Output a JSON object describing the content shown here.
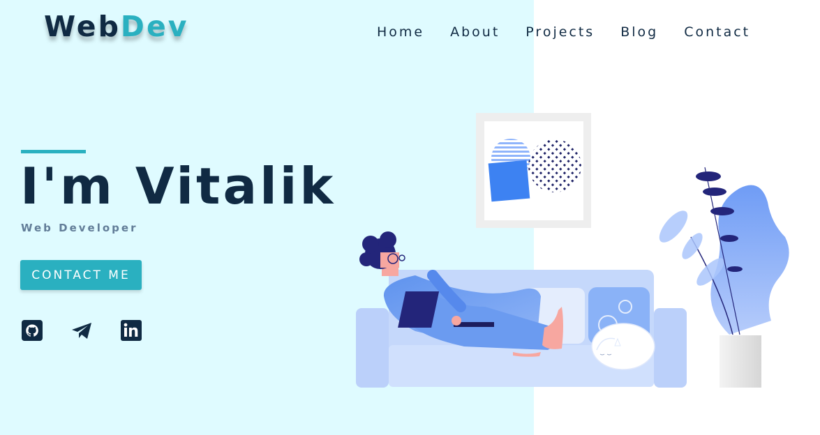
{
  "brand": {
    "part1": "Web",
    "part2": "Dev"
  },
  "nav": {
    "home": "Home",
    "about": "About",
    "projects": "Projects",
    "blog": "Blog",
    "contact": "Contact"
  },
  "hero": {
    "title": "I'm Vitalik",
    "subtitle": "Web Developer",
    "cta": "CONTACT ME"
  },
  "social": [
    "github-icon",
    "telegram-icon",
    "linkedin-icon"
  ],
  "colors": {
    "left_background": "#dffbff",
    "accent": "#2ab0c0",
    "text_dark": "#102a43",
    "text_muted": "#627d98"
  }
}
